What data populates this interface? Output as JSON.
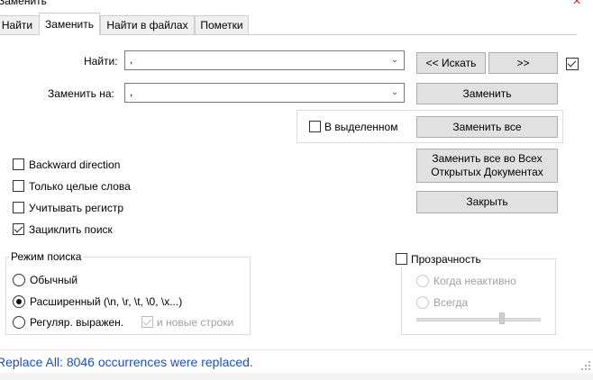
{
  "window": {
    "title": "Заменить",
    "close_glyph": "×"
  },
  "tabs": [
    {
      "label": "Найти"
    },
    {
      "label": "Заменить",
      "active": true
    },
    {
      "label": "Найти в файлах"
    },
    {
      "label": "Пометки"
    }
  ],
  "find": {
    "label": "Найти:",
    "value": ","
  },
  "replace": {
    "label": "Заменить на:",
    "value": ","
  },
  "buttons": {
    "search_back": "<< Искать",
    "search_forward": ">>",
    "replace": "Заменить",
    "replace_all": "Заменить все",
    "replace_all_docs": "Заменить все во Всех Открытых Документах",
    "close": "Закрыть"
  },
  "options": {
    "in_selection": {
      "label": "В выделенном",
      "checked": false
    },
    "backward": {
      "label": "Backward direction",
      "checked": false
    },
    "whole_words": {
      "label": "Только целые слова",
      "checked": false
    },
    "match_case": {
      "label": "Учитывать регистр",
      "checked": false
    },
    "wrap_around": {
      "label": "Зациклить поиск",
      "checked": true
    },
    "top_right_checkbox": {
      "checked": true
    }
  },
  "search_mode": {
    "legend": "Режим поиска",
    "normal": "Обычный",
    "extended": "Расширенный (\\n, \\r, \\t, \\0, \\x...)",
    "regex": "Регуляр. выражен.",
    "newlines": "и новые строки",
    "selected": "extended"
  },
  "transparency": {
    "label": "Прозрачность",
    "on_inactive": "Когда неактивно",
    "always": "Всегда",
    "level": 0.7
  },
  "status": {
    "text": "Replace All: 8046 occurrences were replaced.",
    "color": "#1e50b4"
  }
}
